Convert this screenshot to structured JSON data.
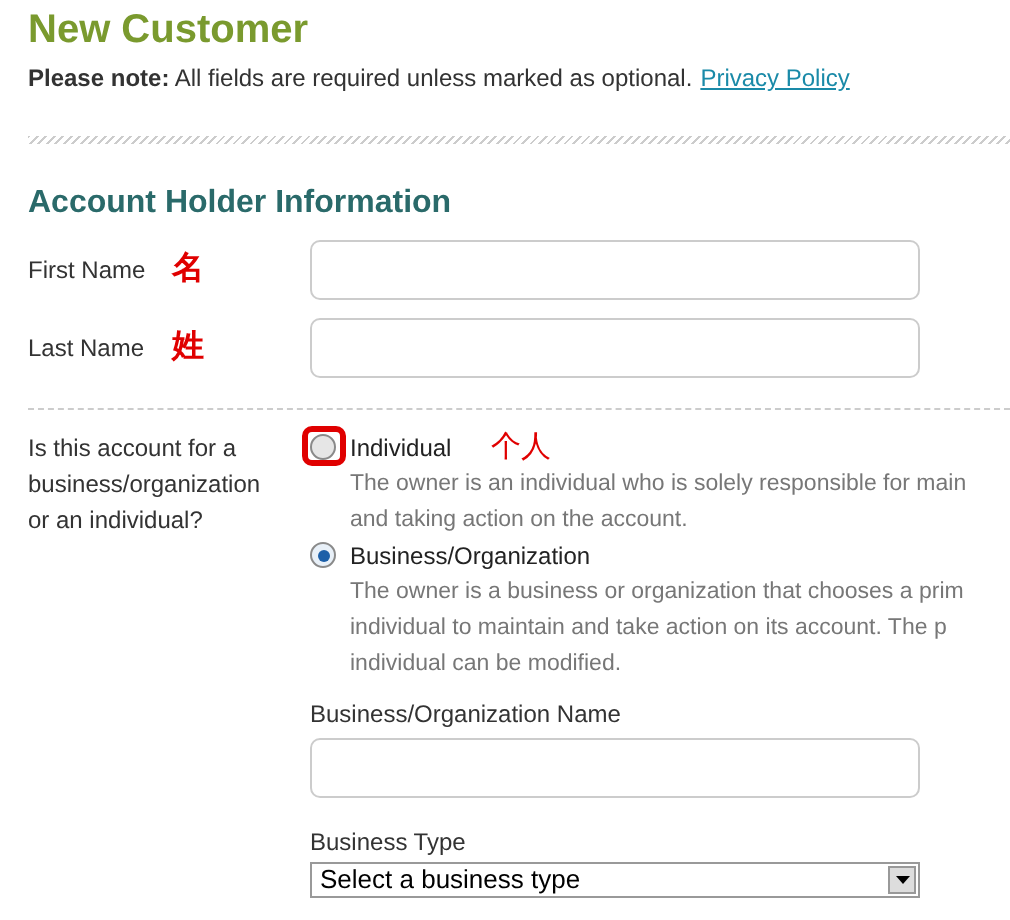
{
  "title": "New Customer",
  "note": {
    "text": "**Please note:** All fields are required unless marked as optional.",
    "link": "Privacy Policy"
  },
  "section": {
    "heading": "Account Holder Information"
  },
  "fields": [
    {
      "label": "First Name",
      "annotation": "名"
    },
    {
      "label": "Last Name",
      "annotation": "姓"
    }
  ],
  "account_type": {
    "question": [
      "Is this account for a",
      "business/organization",
      "or an individual?"
    ],
    "options": [
      {
        "label": "Individual",
        "selected": false,
        "annotation": "个人",
        "circled": true,
        "description": [
          "The owner is an individual who is solely responsible for main",
          "and taking action on the account."
        ]
      },
      {
        "label": "Business/Organization",
        "selected": true,
        "description": [
          "The owner is a business or organization that chooses a prim",
          "individual to maintain and take action on its account. The p",
          "individual can be modified."
        ]
      }
    ]
  },
  "business_name": {
    "label": "Business/Organization Name"
  },
  "business_type": {
    "label": "Business Type",
    "value": "Select a business type"
  }
}
